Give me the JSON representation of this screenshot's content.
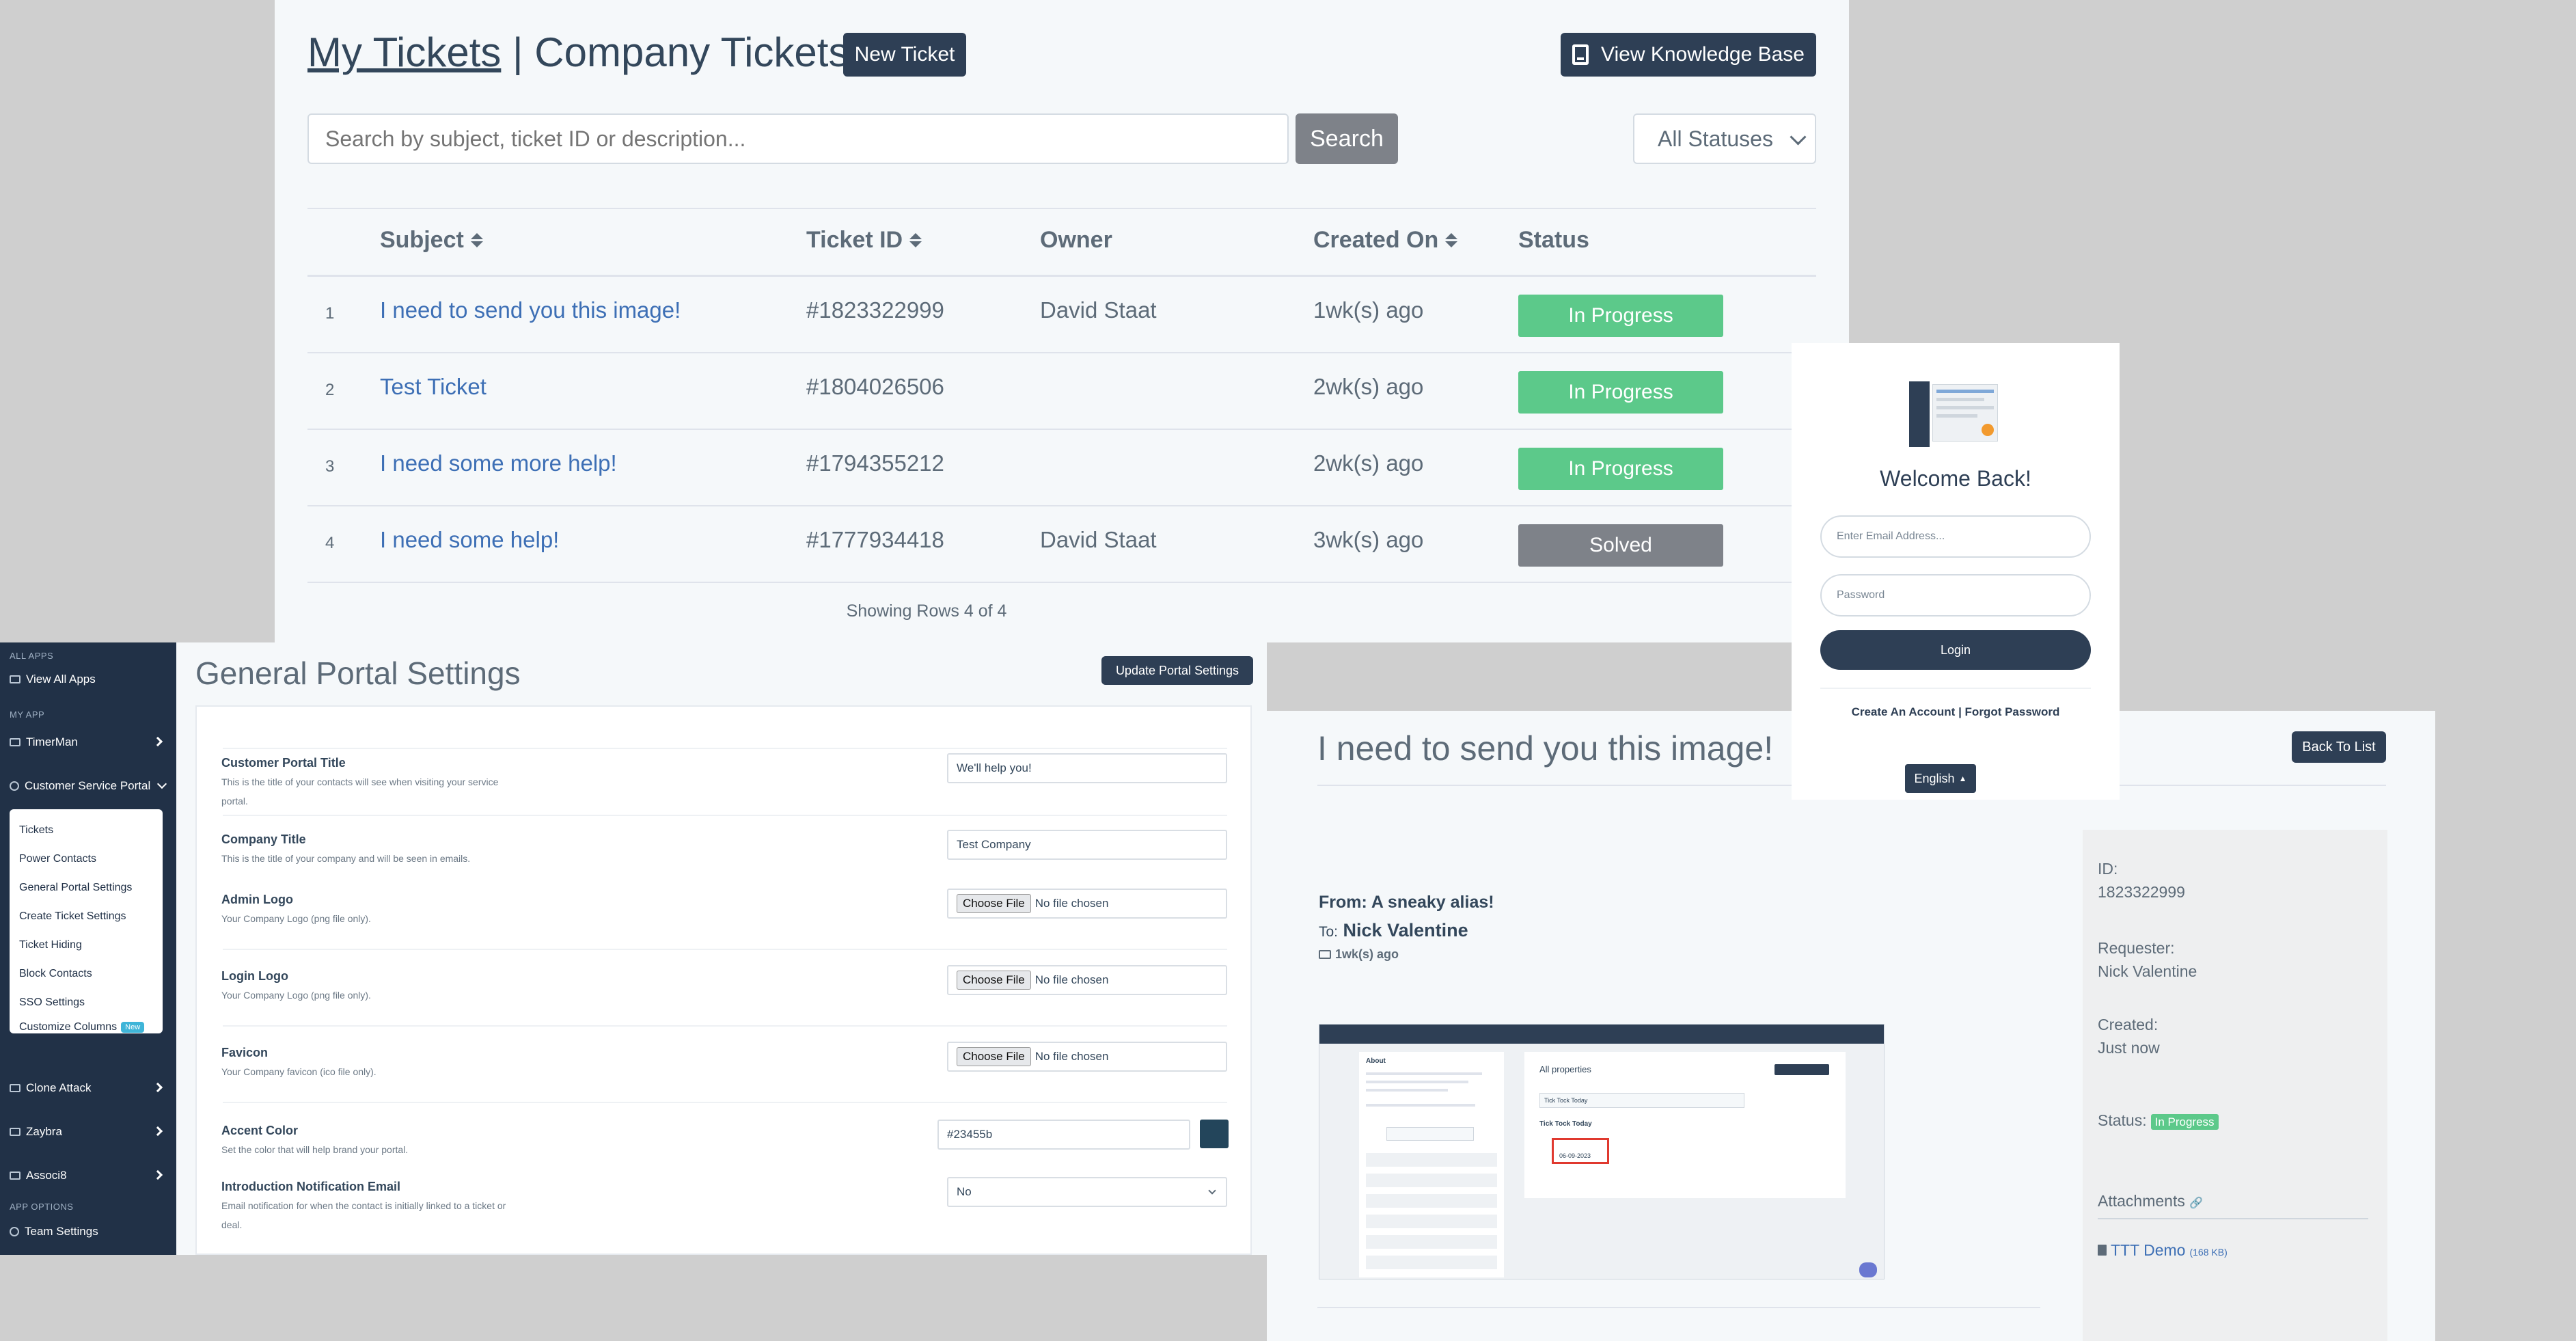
{
  "tickets": {
    "title_mine": "My Tickets",
    "title_sep": " | ",
    "title_company": "Company Tickets",
    "new_ticket": "New Ticket",
    "knowledge_base": "View Knowledge Base",
    "search_placeholder": "Search by subject, ticket ID or description...",
    "search_button": "Search",
    "status_filter": "All Statuses",
    "columns": [
      "Subject",
      "Ticket ID",
      "Owner",
      "Created On",
      "Status"
    ],
    "rows": [
      {
        "num": "1",
        "subject": "I need to send you this image!",
        "id": "#1823322999",
        "owner": "David Staat",
        "created": "1wk(s) ago",
        "status": "In Progress"
      },
      {
        "num": "2",
        "subject": "Test Ticket",
        "id": "#1804026506",
        "owner": "",
        "created": "2wk(s) ago",
        "status": "In Progress"
      },
      {
        "num": "3",
        "subject": "I need some more help!",
        "id": "#1794355212",
        "owner": "",
        "created": "2wk(s) ago",
        "status": "In Progress"
      },
      {
        "num": "4",
        "subject": "I need some help!",
        "id": "#1777934418",
        "owner": "David Staat",
        "created": "3wk(s) ago",
        "status": "Solved"
      }
    ],
    "footer": "Showing Rows 4 of 4"
  },
  "login": {
    "title": "Welcome Back!",
    "email_placeholder": "Enter Email Address...",
    "password_placeholder": "Password",
    "login_button": "Login",
    "links": "Create An Account | Forgot Password",
    "language": "English"
  },
  "sidebar": {
    "section_all_apps": "ALL APPS",
    "view_all_apps": "View All Apps",
    "section_my_app": "MY APP",
    "timerman": "TimerMan",
    "customer_service_portal": "Customer Service Portal",
    "submenu": [
      "Tickets",
      "Power Contacts",
      "General Portal Settings",
      "Create Ticket Settings",
      "Ticket Hiding",
      "Block Contacts",
      "SSO Settings",
      "Customize Columns"
    ],
    "new_badge": "New",
    "clone_attack": "Clone Attack",
    "zaybra": "Zaybra",
    "associ8": "Associ8",
    "section_app_options": "APP OPTIONS",
    "team_settings": "Team Settings"
  },
  "settings": {
    "title": "General Portal Settings",
    "update_button": "Update Portal Settings",
    "portal_title_label": "Customer Portal Title",
    "portal_title_desc": "This is the title of your contacts will see when visiting your service portal.",
    "portal_title_value": "We'll help you!",
    "company_title_label": "Company Title",
    "company_title_desc": "This is the title of your company and will be seen in emails.",
    "company_title_value": "Test Company",
    "admin_logo_label": "Admin Logo",
    "admin_logo_desc": "Your Company Logo (png file only).",
    "login_logo_label": "Login Logo",
    "login_logo_desc": "Your Company Logo (png file only).",
    "favicon_label": "Favicon",
    "favicon_desc": "Your Company favicon (ico file only).",
    "choose_file": "Choose File",
    "no_file": "No file chosen",
    "accent_label": "Accent Color",
    "accent_desc": "Set the color that will help brand your portal.",
    "accent_value": "#23455b",
    "notif_label": "Introduction Notification Email",
    "notif_desc": "Email notification for when the contact is initially linked to a ticket or deal.",
    "notif_value": "No"
  },
  "detail": {
    "title": "I need to send you this image!",
    "back_button": "Back To List",
    "from": "From: A sneaky alias!",
    "to_label": "To:",
    "to_name": "Nick Valentine",
    "time": "1wk(s) ago",
    "id_label": "ID:",
    "id_value": "1823322999",
    "requester_label": "Requester:",
    "requester_value": "Nick Valentine",
    "created_label": "Created:",
    "created_value": "Just now",
    "status_label": "Status:",
    "status_value": "In Progress",
    "attachments_label": "Attachments",
    "attachment_name": "TTT Demo",
    "attachment_size": "(168 KB)"
  },
  "embedded_screenshot": {
    "panel_left_title": "About",
    "panel_right_title": "All properties",
    "search_text": "Tick Tock Today",
    "group_title": "Tick Tock Today",
    "date_value": "06-09-2023"
  }
}
